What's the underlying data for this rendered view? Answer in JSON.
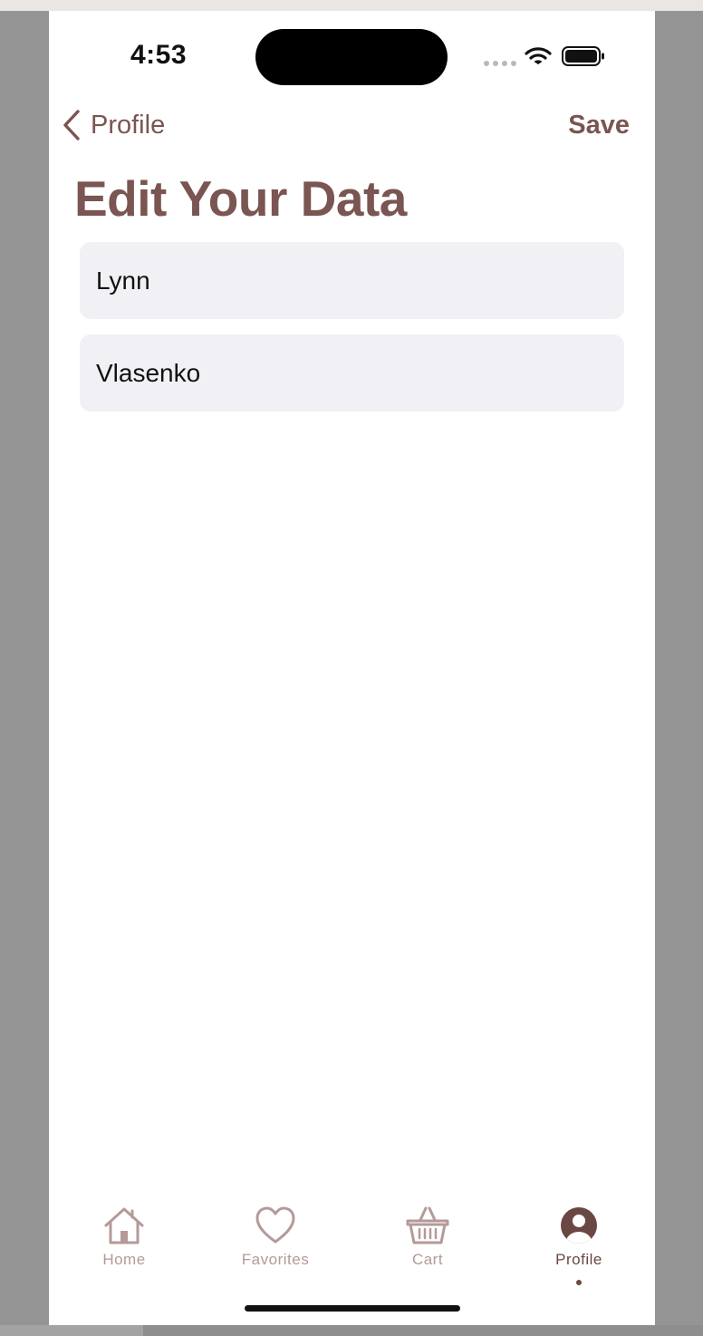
{
  "status_bar": {
    "time": "4:53",
    "icons": [
      "signal-dots-icon",
      "wifi-icon",
      "battery-icon"
    ]
  },
  "nav": {
    "back_label": "Profile",
    "save_label": "Save"
  },
  "page": {
    "title": "Edit Your Data"
  },
  "form": {
    "first_name": {
      "value": "Lynn"
    },
    "last_name": {
      "value": "Vlasenko"
    }
  },
  "tab_bar": {
    "items": [
      {
        "label": "Home",
        "icon": "home-icon"
      },
      {
        "label": "Favorites",
        "icon": "heart-icon"
      },
      {
        "label": "Cart",
        "icon": "basket-icon"
      },
      {
        "label": "Profile",
        "icon": "person-circle-icon"
      }
    ],
    "active": "Profile"
  },
  "colors": {
    "accent": "#7a5552",
    "tab_inactive": "#b49a98",
    "field_bg": "#f1f0f5",
    "background": "#ffffff"
  }
}
